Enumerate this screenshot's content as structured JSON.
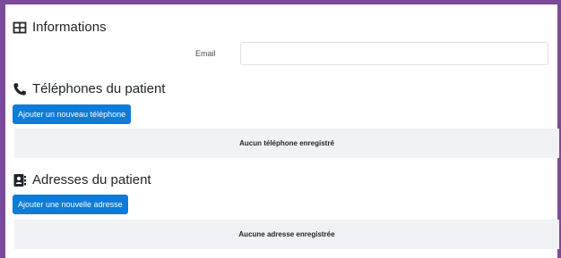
{
  "informations": {
    "title": "Informations",
    "icon": "table-grid-icon",
    "email_label": "Email",
    "email_value": "",
    "email_placeholder": ""
  },
  "telephones": {
    "title": "Téléphones du patient",
    "icon": "phone-icon",
    "add_button_label": "Ajouter un nouveau téléphone",
    "empty_text": "Aucun téléphone enregistré"
  },
  "adresses": {
    "title": "Adresses du patient",
    "icon": "address-book-icon",
    "add_button_label": "Ajouter une nouvelle adresse",
    "empty_text": "Aucune adresse enregistrée"
  },
  "colors": {
    "frame": "#7b4a9b",
    "primary_button": "#0d7bd8",
    "empty_row_bg": "#f0f2f5"
  }
}
